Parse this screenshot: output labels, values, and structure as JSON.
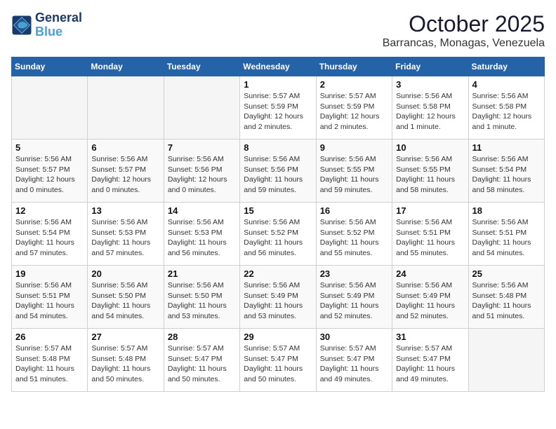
{
  "header": {
    "logo_line1": "General",
    "logo_line2": "Blue",
    "month": "October 2025",
    "location": "Barrancas, Monagas, Venezuela"
  },
  "weekdays": [
    "Sunday",
    "Monday",
    "Tuesday",
    "Wednesday",
    "Thursday",
    "Friday",
    "Saturday"
  ],
  "weeks": [
    [
      {
        "day": "",
        "info": ""
      },
      {
        "day": "",
        "info": ""
      },
      {
        "day": "",
        "info": ""
      },
      {
        "day": "1",
        "info": "Sunrise: 5:57 AM\nSunset: 5:59 PM\nDaylight: 12 hours\nand 2 minutes."
      },
      {
        "day": "2",
        "info": "Sunrise: 5:57 AM\nSunset: 5:59 PM\nDaylight: 12 hours\nand 2 minutes."
      },
      {
        "day": "3",
        "info": "Sunrise: 5:56 AM\nSunset: 5:58 PM\nDaylight: 12 hours\nand 1 minute."
      },
      {
        "day": "4",
        "info": "Sunrise: 5:56 AM\nSunset: 5:58 PM\nDaylight: 12 hours\nand 1 minute."
      }
    ],
    [
      {
        "day": "5",
        "info": "Sunrise: 5:56 AM\nSunset: 5:57 PM\nDaylight: 12 hours\nand 0 minutes."
      },
      {
        "day": "6",
        "info": "Sunrise: 5:56 AM\nSunset: 5:57 PM\nDaylight: 12 hours\nand 0 minutes."
      },
      {
        "day": "7",
        "info": "Sunrise: 5:56 AM\nSunset: 5:56 PM\nDaylight: 12 hours\nand 0 minutes."
      },
      {
        "day": "8",
        "info": "Sunrise: 5:56 AM\nSunset: 5:56 PM\nDaylight: 11 hours\nand 59 minutes."
      },
      {
        "day": "9",
        "info": "Sunrise: 5:56 AM\nSunset: 5:55 PM\nDaylight: 11 hours\nand 59 minutes."
      },
      {
        "day": "10",
        "info": "Sunrise: 5:56 AM\nSunset: 5:55 PM\nDaylight: 11 hours\nand 58 minutes."
      },
      {
        "day": "11",
        "info": "Sunrise: 5:56 AM\nSunset: 5:54 PM\nDaylight: 11 hours\nand 58 minutes."
      }
    ],
    [
      {
        "day": "12",
        "info": "Sunrise: 5:56 AM\nSunset: 5:54 PM\nDaylight: 11 hours\nand 57 minutes."
      },
      {
        "day": "13",
        "info": "Sunrise: 5:56 AM\nSunset: 5:53 PM\nDaylight: 11 hours\nand 57 minutes."
      },
      {
        "day": "14",
        "info": "Sunrise: 5:56 AM\nSunset: 5:53 PM\nDaylight: 11 hours\nand 56 minutes."
      },
      {
        "day": "15",
        "info": "Sunrise: 5:56 AM\nSunset: 5:52 PM\nDaylight: 11 hours\nand 56 minutes."
      },
      {
        "day": "16",
        "info": "Sunrise: 5:56 AM\nSunset: 5:52 PM\nDaylight: 11 hours\nand 55 minutes."
      },
      {
        "day": "17",
        "info": "Sunrise: 5:56 AM\nSunset: 5:51 PM\nDaylight: 11 hours\nand 55 minutes."
      },
      {
        "day": "18",
        "info": "Sunrise: 5:56 AM\nSunset: 5:51 PM\nDaylight: 11 hours\nand 54 minutes."
      }
    ],
    [
      {
        "day": "19",
        "info": "Sunrise: 5:56 AM\nSunset: 5:51 PM\nDaylight: 11 hours\nand 54 minutes."
      },
      {
        "day": "20",
        "info": "Sunrise: 5:56 AM\nSunset: 5:50 PM\nDaylight: 11 hours\nand 54 minutes."
      },
      {
        "day": "21",
        "info": "Sunrise: 5:56 AM\nSunset: 5:50 PM\nDaylight: 11 hours\nand 53 minutes."
      },
      {
        "day": "22",
        "info": "Sunrise: 5:56 AM\nSunset: 5:49 PM\nDaylight: 11 hours\nand 53 minutes."
      },
      {
        "day": "23",
        "info": "Sunrise: 5:56 AM\nSunset: 5:49 PM\nDaylight: 11 hours\nand 52 minutes."
      },
      {
        "day": "24",
        "info": "Sunrise: 5:56 AM\nSunset: 5:49 PM\nDaylight: 11 hours\nand 52 minutes."
      },
      {
        "day": "25",
        "info": "Sunrise: 5:56 AM\nSunset: 5:48 PM\nDaylight: 11 hours\nand 51 minutes."
      }
    ],
    [
      {
        "day": "26",
        "info": "Sunrise: 5:57 AM\nSunset: 5:48 PM\nDaylight: 11 hours\nand 51 minutes."
      },
      {
        "day": "27",
        "info": "Sunrise: 5:57 AM\nSunset: 5:48 PM\nDaylight: 11 hours\nand 50 minutes."
      },
      {
        "day": "28",
        "info": "Sunrise: 5:57 AM\nSunset: 5:47 PM\nDaylight: 11 hours\nand 50 minutes."
      },
      {
        "day": "29",
        "info": "Sunrise: 5:57 AM\nSunset: 5:47 PM\nDaylight: 11 hours\nand 50 minutes."
      },
      {
        "day": "30",
        "info": "Sunrise: 5:57 AM\nSunset: 5:47 PM\nDaylight: 11 hours\nand 49 minutes."
      },
      {
        "day": "31",
        "info": "Sunrise: 5:57 AM\nSunset: 5:47 PM\nDaylight: 11 hours\nand 49 minutes."
      },
      {
        "day": "",
        "info": ""
      }
    ]
  ]
}
